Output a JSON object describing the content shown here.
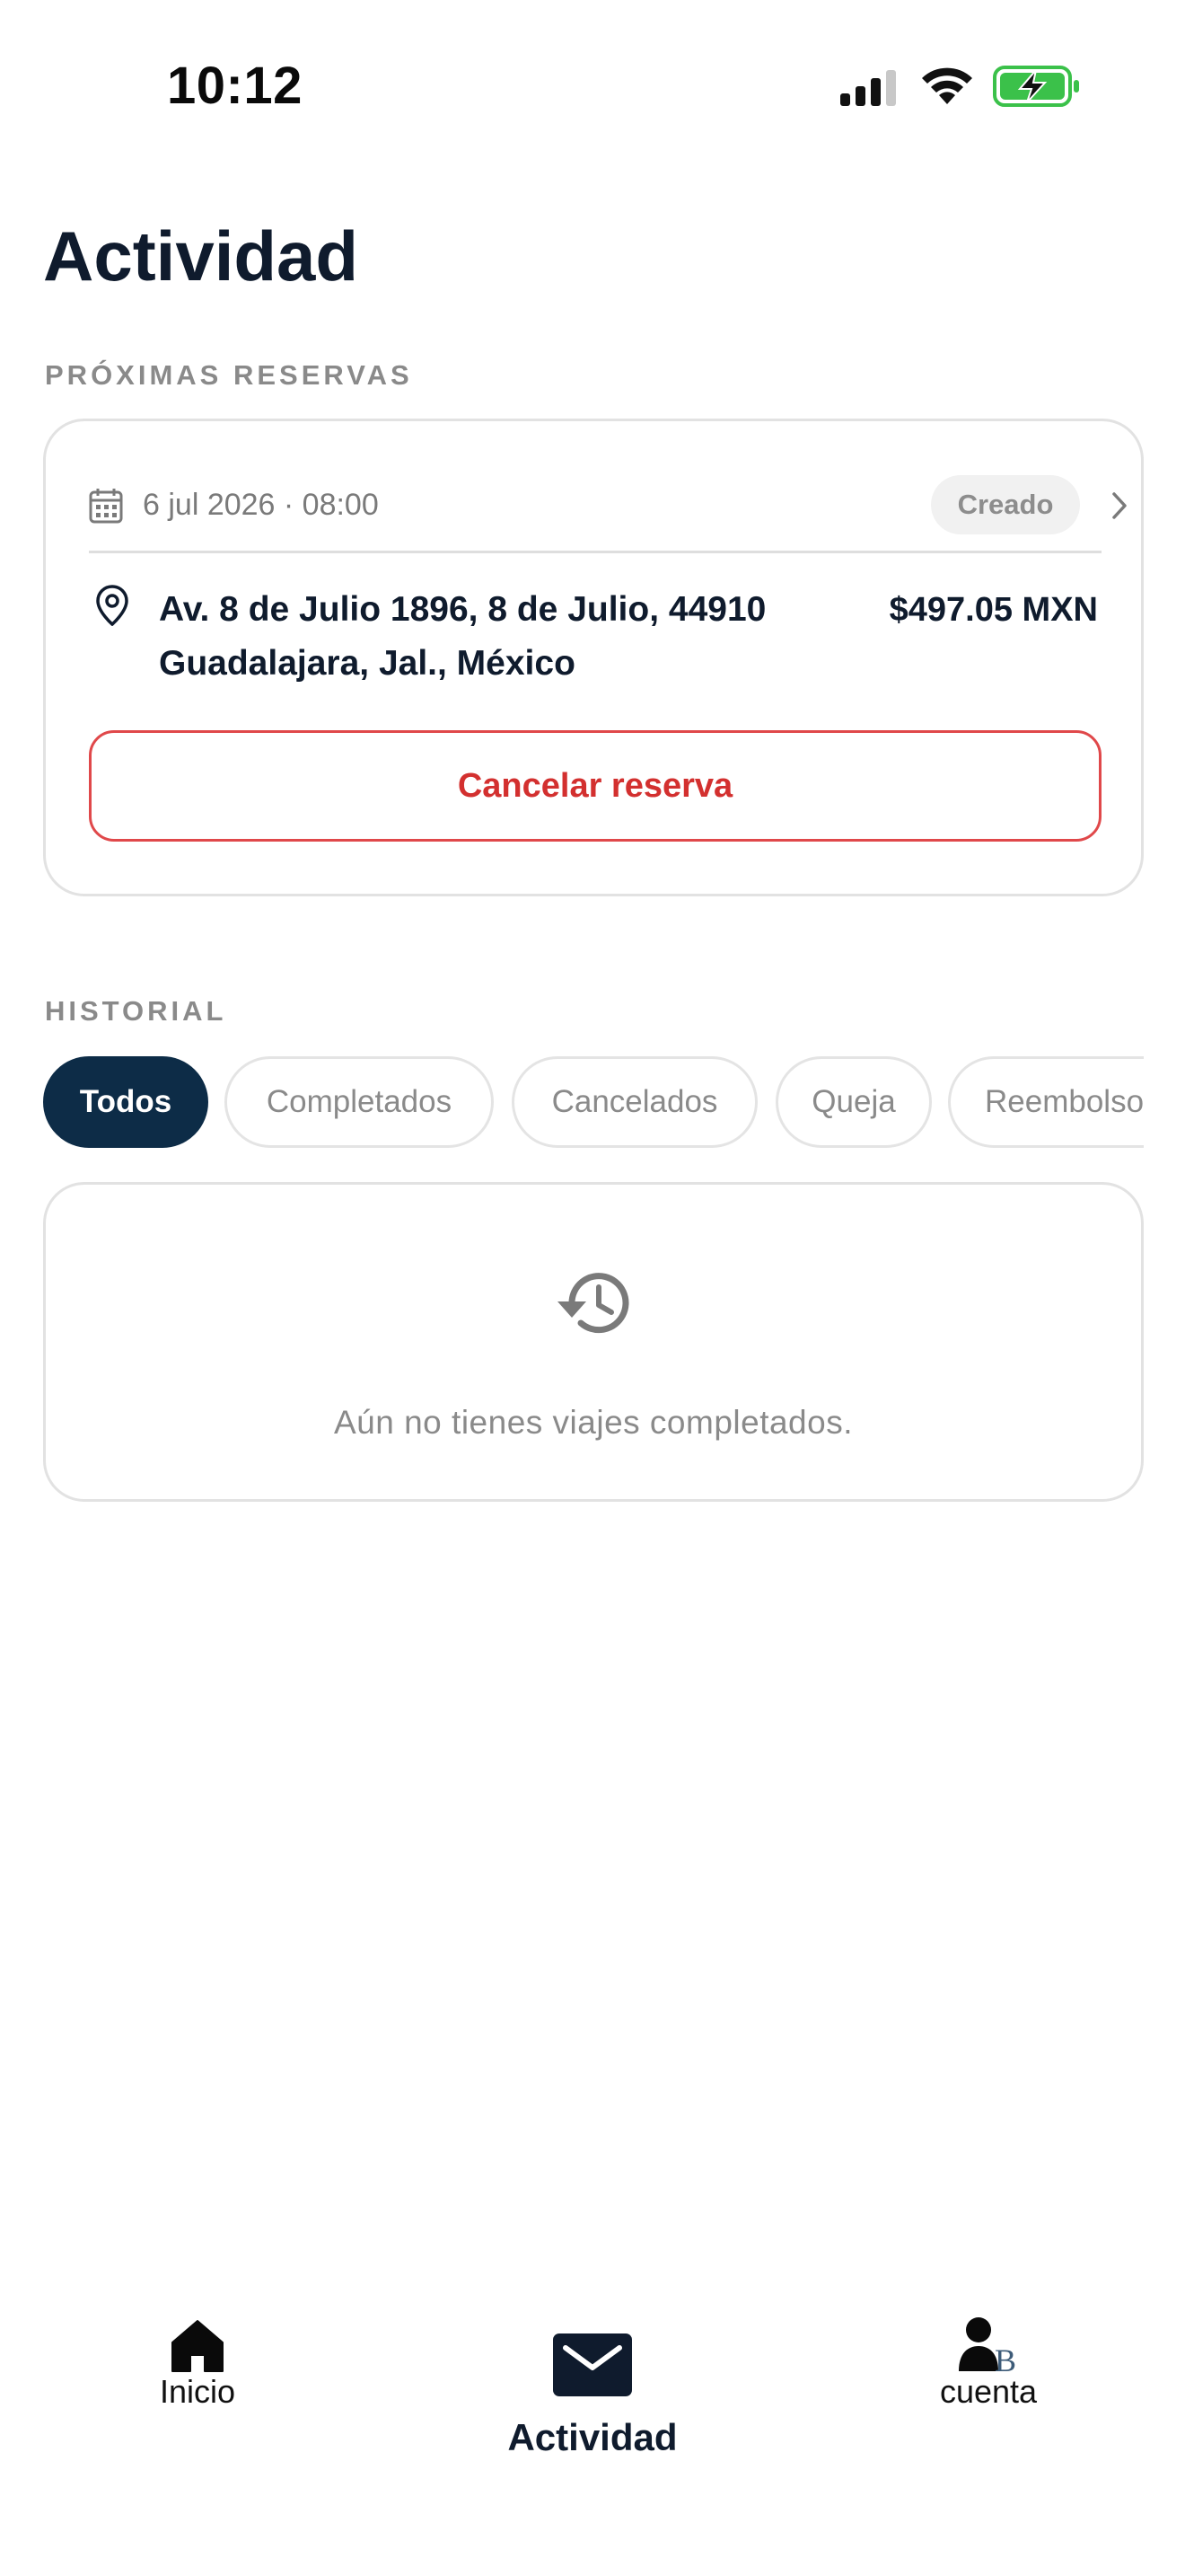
{
  "status_bar": {
    "time": "10:12"
  },
  "header": {
    "title": "Actividad"
  },
  "upcoming": {
    "section_label": "PRÓXIMAS RESERVAS",
    "booking": {
      "date": "6 jul 2026 · 08:00",
      "status": "Creado",
      "address_line1": "Av. 8 de Julio 1896, 8 de Julio, 44910",
      "address_line2": "Guadalajara, Jal., México",
      "price": "$497.05 MXN",
      "cancel_label": "Cancelar reserva"
    }
  },
  "history": {
    "section_label": "HISTORIAL",
    "filters": [
      "Todos",
      "Completados",
      "Cancelados",
      "Queja",
      "Reembolso"
    ],
    "active_filter": "Todos",
    "empty_message": "Aún no tienes viajes completados."
  },
  "tab_bar": {
    "items": [
      {
        "label": "Inicio",
        "icon": "home-icon"
      },
      {
        "label": "Actividad",
        "icon": "mail-icon",
        "active": true
      },
      {
        "label": "cuenta",
        "icon": "account-icon"
      }
    ]
  },
  "colors": {
    "primary": "#0d2c47",
    "danger": "#d3302f",
    "muted": "#8a8a8a",
    "battery_green": "#3bc14a"
  }
}
